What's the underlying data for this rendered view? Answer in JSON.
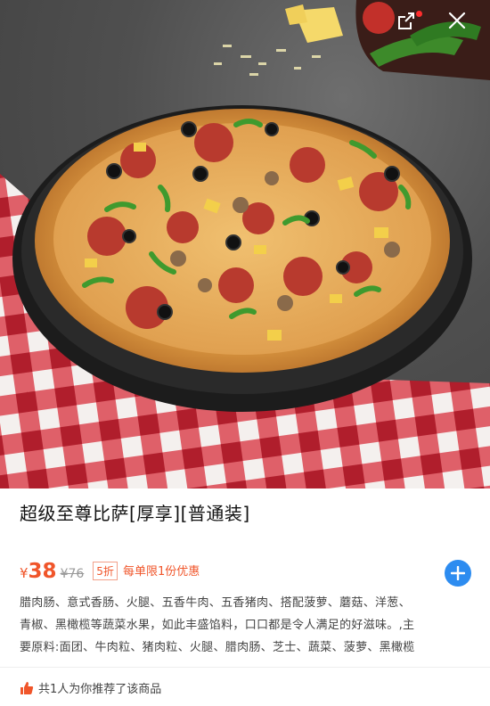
{
  "header": {
    "share_icon": "share-icon",
    "close_icon": "close-icon",
    "badge_color": "#ff2d2d"
  },
  "product": {
    "title": "超级至尊比萨[厚享][普通装]",
    "currency": "¥",
    "price": "38",
    "original_price": "¥76",
    "discount": "5折",
    "limit_note": "每单限1份优惠",
    "description": "腊肉肠、意式香肠、火腿、五香牛肉、五香猪肉、搭配菠萝、蘑菇、洋葱、\n青椒、黑橄榄等蔬菜水果，如此丰盛馅料，口口都是令人满足的好滋味。,主\n要原料:面团、牛肉粒、猪肉粒、火腿、腊肉肠、芝士、蔬菜、菠萝、黑橄榄",
    "add_icon": "plus-icon"
  },
  "recommend": {
    "text": "共1人为你推荐了该商品",
    "icon": "thumbs-up-icon"
  },
  "colors": {
    "accent": "#f0552a",
    "add_button": "#2d8cf0"
  }
}
